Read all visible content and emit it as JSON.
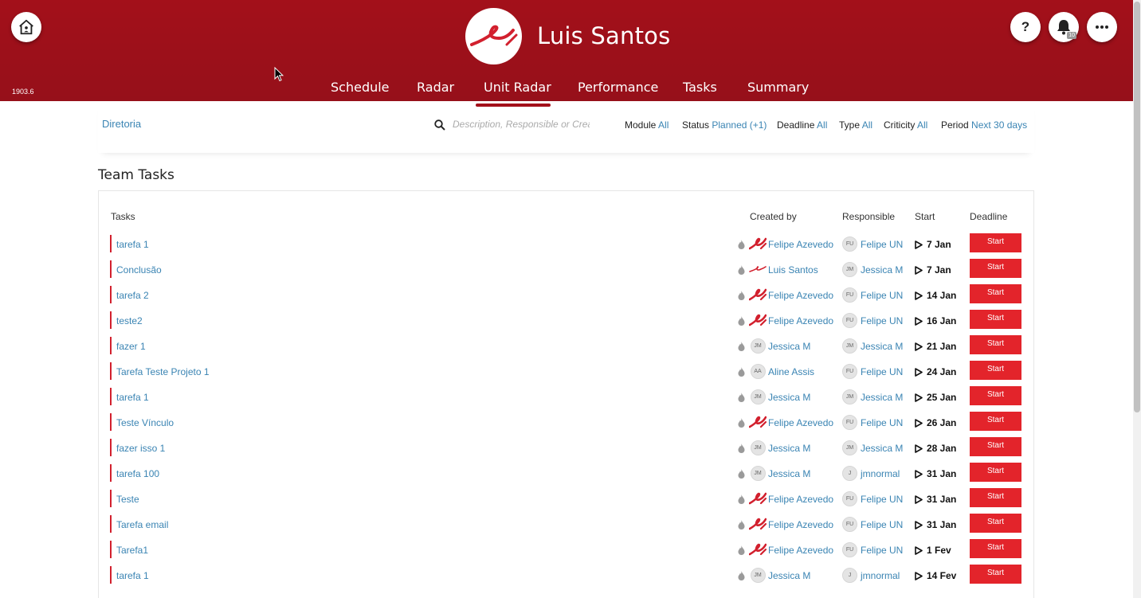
{
  "header": {
    "version": "1903.6",
    "user_name": "Luis Santos",
    "help_label": "?",
    "notification_count": "10",
    "nav": [
      "Schedule",
      "Radar",
      "Unit Radar",
      "Performance",
      "Tasks",
      "Summary"
    ],
    "active_nav": "Unit Radar"
  },
  "filters": {
    "breadcrumb": "Diretoria",
    "search_placeholder": "Description, Responsible or Creator",
    "module": {
      "label": "Module",
      "value": "All"
    },
    "status": {
      "label": "Status",
      "value": "Planned (+1)"
    },
    "deadline": {
      "label": "Deadline",
      "value": "All"
    },
    "type": {
      "label": "Type",
      "value": "All"
    },
    "criticity": {
      "label": "Criticity",
      "value": "All"
    },
    "period": {
      "label": "Period",
      "value": "Next 30 days"
    }
  },
  "section_title": "Team Tasks",
  "table": {
    "headers": {
      "tasks": "Tasks",
      "created_by": "Created by",
      "responsible": "Responsible",
      "start": "Start",
      "deadline": "Deadline"
    },
    "start_button": "Start",
    "rows": [
      {
        "task": "tarefa 1",
        "created_by": "Felipe Azevedo",
        "cr_initials": "",
        "cr_logo": "big",
        "responsible": "Felipe UN",
        "rp_initials": "FU",
        "start": "7 Jan"
      },
      {
        "task": "Conclusão",
        "created_by": "Luis Santos",
        "cr_initials": "",
        "cr_logo": "small",
        "responsible": "Jessica M",
        "rp_initials": "JM",
        "start": "7 Jan"
      },
      {
        "task": "tarefa 2",
        "created_by": "Felipe Azevedo",
        "cr_initials": "",
        "cr_logo": "big",
        "responsible": "Felipe UN",
        "rp_initials": "FU",
        "start": "14 Jan"
      },
      {
        "task": "teste2",
        "created_by": "Felipe Azevedo",
        "cr_initials": "",
        "cr_logo": "big",
        "responsible": "Felipe UN",
        "rp_initials": "FU",
        "start": "16 Jan"
      },
      {
        "task": "fazer 1",
        "created_by": "Jessica M",
        "cr_initials": "JM",
        "cr_logo": "",
        "responsible": "Jessica M",
        "rp_initials": "JM",
        "start": "21 Jan"
      },
      {
        "task": "Tarefa Teste Projeto 1",
        "created_by": "Aline Assis",
        "cr_initials": "AA",
        "cr_logo": "",
        "responsible": "Felipe UN",
        "rp_initials": "FU",
        "start": "24 Jan"
      },
      {
        "task": "tarefa 1",
        "created_by": "Jessica M",
        "cr_initials": "JM",
        "cr_logo": "",
        "responsible": "Jessica M",
        "rp_initials": "JM",
        "start": "25 Jan"
      },
      {
        "task": "Teste Vínculo",
        "created_by": "Felipe Azevedo",
        "cr_initials": "",
        "cr_logo": "big",
        "responsible": "Felipe UN",
        "rp_initials": "FU",
        "start": "26 Jan"
      },
      {
        "task": "fazer isso 1",
        "created_by": "Jessica M",
        "cr_initials": "JM",
        "cr_logo": "",
        "responsible": "Jessica M",
        "rp_initials": "JM",
        "start": "28 Jan"
      },
      {
        "task": "tarefa 100",
        "created_by": "Jessica M",
        "cr_initials": "JM",
        "cr_logo": "",
        "responsible": "jmnormal",
        "rp_initials": "J",
        "start": "31 Jan"
      },
      {
        "task": "Teste",
        "created_by": "Felipe Azevedo",
        "cr_initials": "",
        "cr_logo": "big",
        "responsible": "Felipe UN",
        "rp_initials": "FU",
        "start": "31 Jan"
      },
      {
        "task": "Tarefa email",
        "created_by": "Felipe Azevedo",
        "cr_initials": "",
        "cr_logo": "big",
        "responsible": "Felipe UN",
        "rp_initials": "FU",
        "start": "31 Jan"
      },
      {
        "task": "Tarefa1",
        "created_by": "Felipe Azevedo",
        "cr_initials": "",
        "cr_logo": "big",
        "responsible": "Felipe UN",
        "rp_initials": "FU",
        "start": "1 Fev"
      },
      {
        "task": "tarefa 1",
        "created_by": "Jessica M",
        "cr_initials": "JM",
        "cr_logo": "",
        "responsible": "jmnormal",
        "rp_initials": "J",
        "start": "14 Fev"
      }
    ]
  },
  "colors": {
    "brand": "#a3101a",
    "link": "#3a84b3",
    "button": "#e3242b"
  },
  "icons": [
    "home-icon",
    "help-icon",
    "bell-icon",
    "more-icon",
    "search-icon",
    "flame-icon",
    "play-icon",
    "logo-swoosh-icon",
    "mouse-cursor-icon"
  ]
}
